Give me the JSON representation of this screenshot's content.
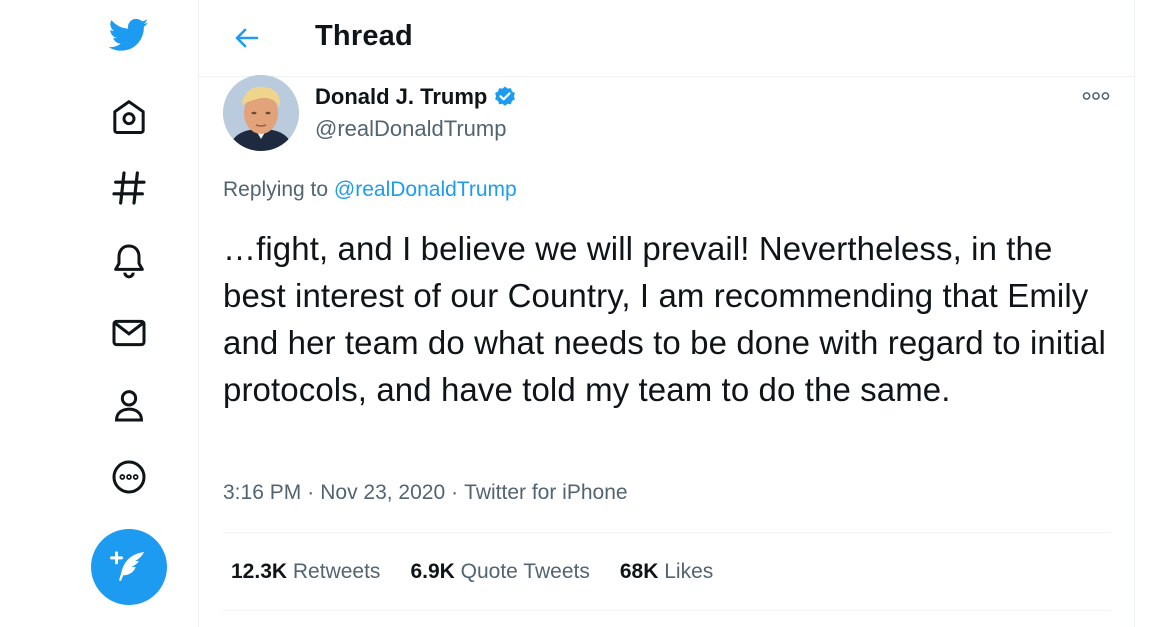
{
  "nav": {
    "logo": "twitter-bird-icon",
    "items": [
      {
        "icon": "home-icon"
      },
      {
        "icon": "explore-hashtag-icon"
      },
      {
        "icon": "notifications-bell-icon"
      },
      {
        "icon": "messages-mail-icon"
      },
      {
        "icon": "profile-icon"
      },
      {
        "icon": "more-circle-icon"
      }
    ],
    "compose_icon": "compose-feather-icon"
  },
  "header": {
    "title": "Thread"
  },
  "tweet": {
    "display_name": "Donald J. Trump",
    "username": "@realDonaldTrump",
    "replying_prefix": "Replying to",
    "replying_handle": "@realDonaldTrump",
    "text": "…fight, and I believe we will prevail! Nevertheless, in the best interest of our Country, I am recommending that Emily and her team do what needs to be done with regard to initial protocols, and have told my team to do the same.",
    "time": "3:16 PM",
    "date": "Nov 23, 2020",
    "source": "Twitter for iPhone",
    "stats": {
      "retweets_count": "12.3K",
      "retweets_label": "Retweets",
      "quotes_count": "6.9K",
      "quotes_label": "Quote Tweets",
      "likes_count": "68K",
      "likes_label": "Likes"
    }
  },
  "colors": {
    "accent": "#1d9bf0",
    "secondary_text": "#536471",
    "primary_text": "#0f1419"
  }
}
